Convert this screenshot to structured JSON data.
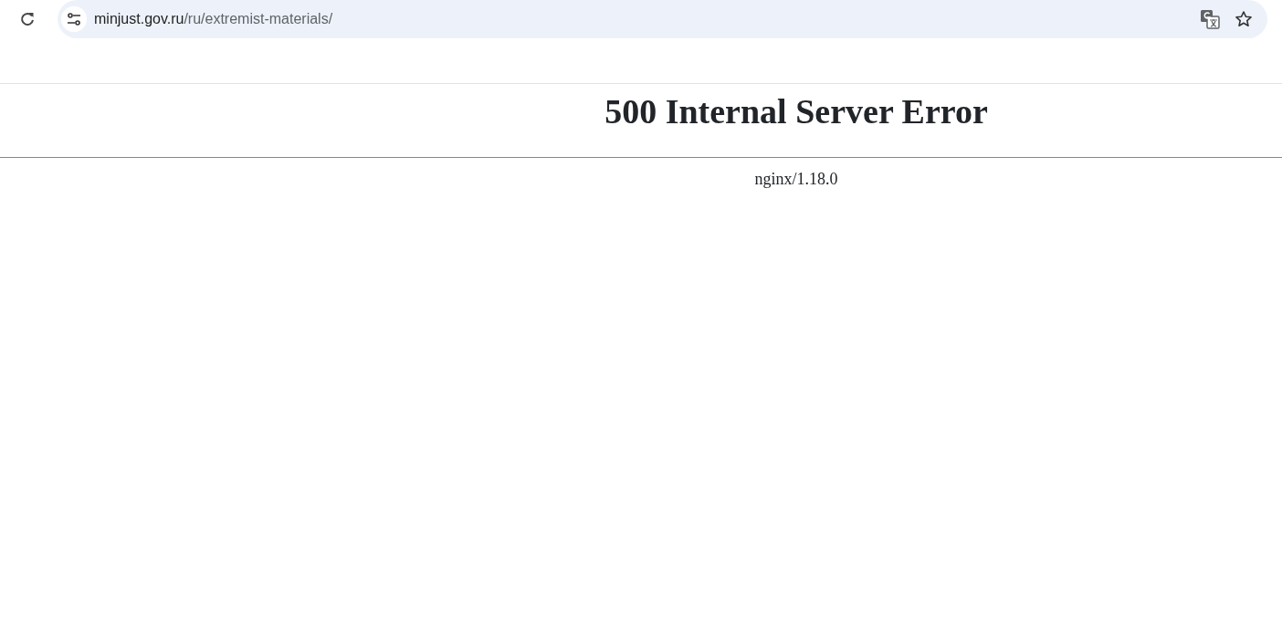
{
  "address_bar": {
    "host": "minjust.gov.ru",
    "path": "/ru/extremist-materials/"
  },
  "page": {
    "title": "500 Internal Server Error",
    "server": "nginx/1.18.0"
  }
}
